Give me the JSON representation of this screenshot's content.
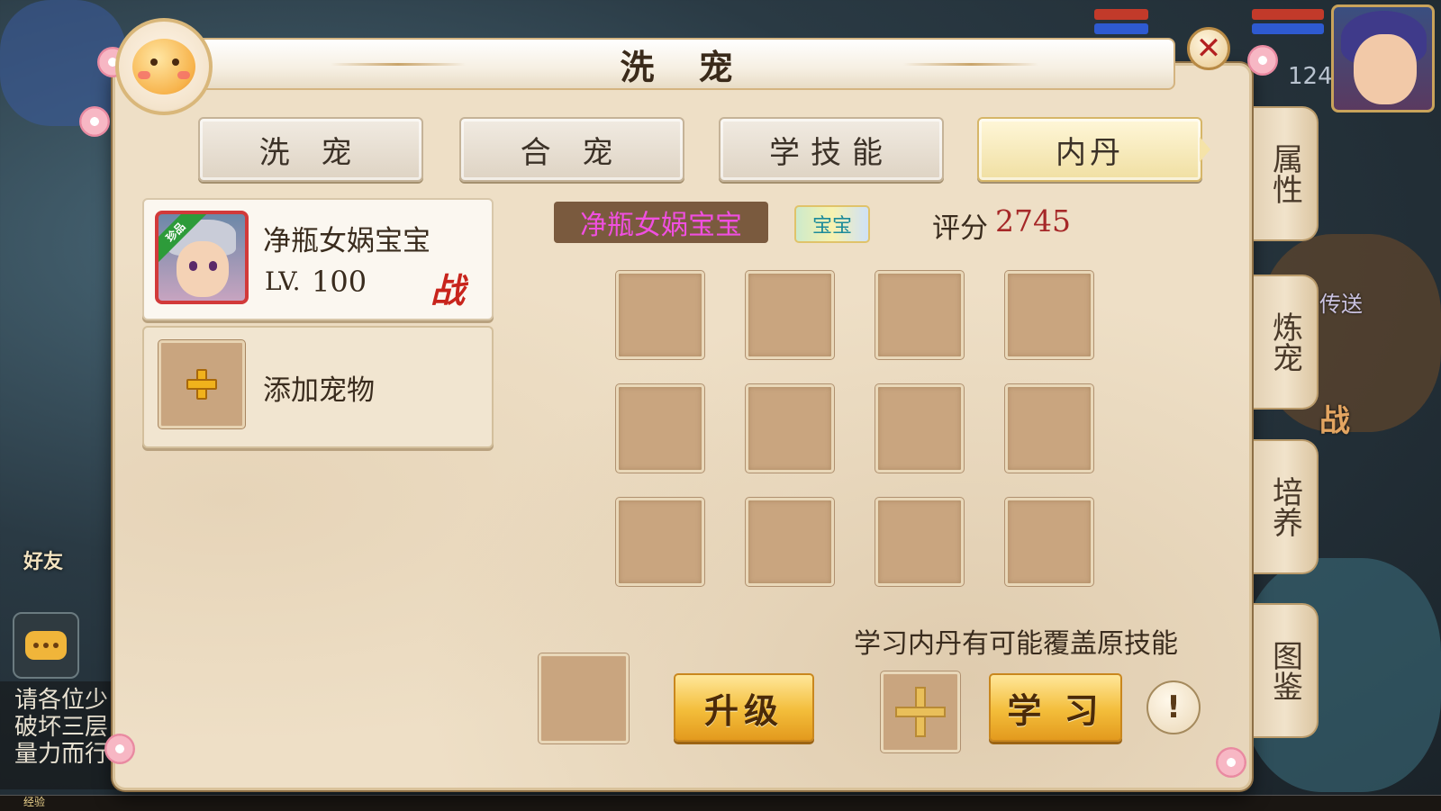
{
  "window": {
    "title": "洗 宠"
  },
  "tabs": [
    {
      "label": "洗 宠",
      "active": false
    },
    {
      "label": "合 宠",
      "active": false
    },
    {
      "label": "学技能",
      "active": false
    },
    {
      "label": "内丹",
      "active": true
    }
  ],
  "side_tabs": [
    {
      "label": "属性"
    },
    {
      "label": "炼宠"
    },
    {
      "label": "培养"
    },
    {
      "label": "图鉴"
    }
  ],
  "pet_list": {
    "selected": {
      "name": "净瓶女娲宝宝",
      "level_label": "LV.",
      "level": "100",
      "badge": "珍品",
      "battle_mark": "战"
    },
    "add_pet_label": "添加宠物"
  },
  "pet_detail": {
    "name_tag": "净瓶女娲宝宝",
    "type_badge": "宝宝",
    "score_label": "评分",
    "score_value": "2745",
    "skill_slots": 12
  },
  "actions": {
    "hint": "学习内丹有可能覆盖原技能",
    "upgrade_label": "升级",
    "learn_label": "学 习",
    "info_label": "!"
  },
  "background_hud": {
    "player_level": "124",
    "friend_label": "好友",
    "chat_lines": [
      "请各位少",
      "破坏三层",
      "量力而行"
    ],
    "xp_label": "经验",
    "side_texts": [
      "传送",
      "战"
    ]
  },
  "colors": {
    "panel_bg": "#eedfc6",
    "active_tab": "#f0dfa2",
    "gold_button": "#f3bd3a",
    "pet_name_tag_text": "#f04fe0",
    "score_value": "#a62828",
    "close_x": "#b32020"
  },
  "icons": {
    "close": "close-x-icon",
    "add": "plus-icon",
    "info": "exclamation-icon",
    "chat": "chat-bubble-icon"
  }
}
